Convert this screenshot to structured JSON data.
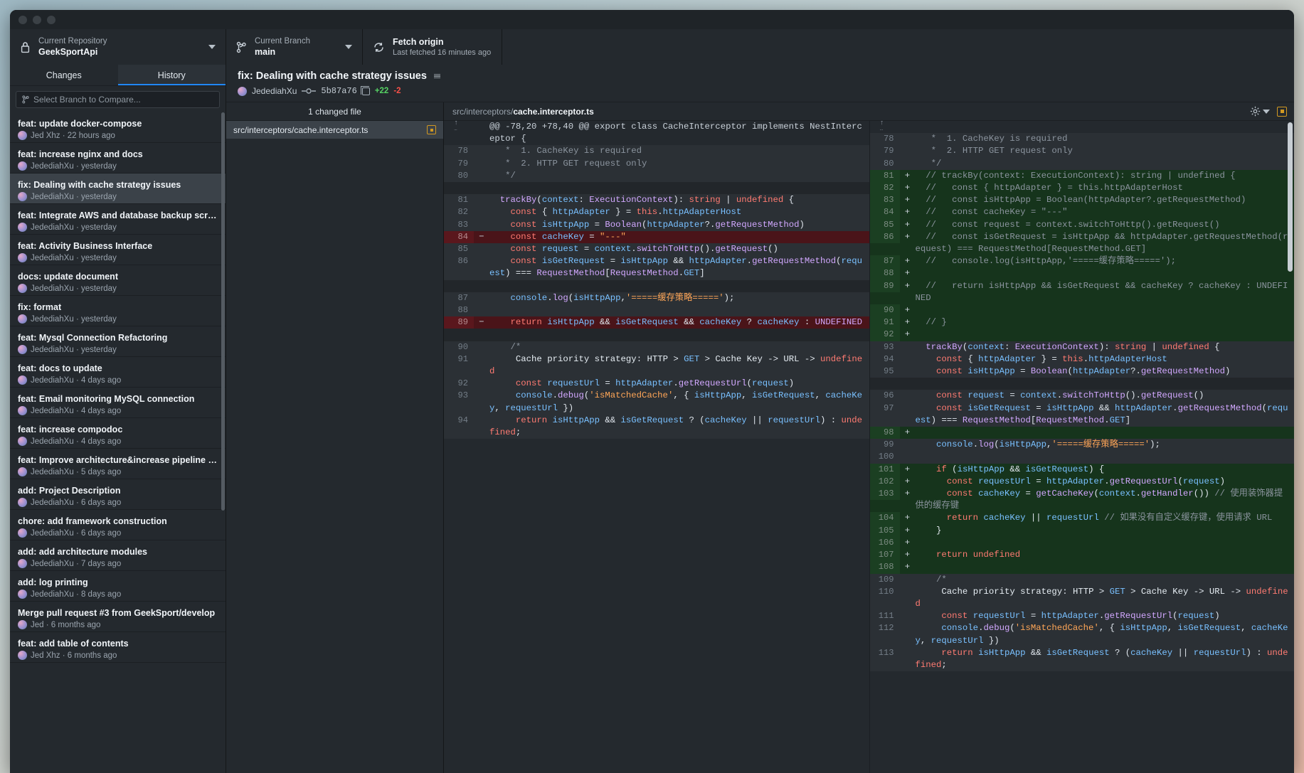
{
  "window": {
    "traffic_lights": 3
  },
  "toolbar": {
    "repo": {
      "label": "Current Repository",
      "value": "GeekSportApi",
      "icon": "lock-icon"
    },
    "branch": {
      "label": "Current Branch",
      "value": "main",
      "icon": "branch-icon"
    },
    "fetch": {
      "title": "Fetch origin",
      "subtitle": "Last fetched 16 minutes ago",
      "icon": "sync-icon"
    }
  },
  "sidebar": {
    "tabs": [
      {
        "label": "Changes",
        "active": false
      },
      {
        "label": "History",
        "active": true
      }
    ],
    "compare": {
      "placeholder": "Select Branch to Compare...",
      "icon": "branch-icon"
    },
    "commits": [
      {
        "title": "feat:  update docker-compose",
        "author": "Jed Xhz",
        "when": "22 hours ago",
        "selected": false
      },
      {
        "title": "feat: increase nginx and docs",
        "author": "JedediahXu",
        "when": "yesterday",
        "selected": false
      },
      {
        "title": "fix: Dealing with cache strategy issues",
        "author": "JedediahXu",
        "when": "yesterday",
        "selected": true
      },
      {
        "title": "feat: Integrate AWS and database backup scripts",
        "author": "JedediahXu",
        "when": "yesterday",
        "selected": false
      },
      {
        "title": "feat: Activity Business Interface",
        "author": "JedediahXu",
        "when": "yesterday",
        "selected": false
      },
      {
        "title": "docs: update document",
        "author": "JedediahXu",
        "when": "yesterday",
        "selected": false
      },
      {
        "title": "fix: format",
        "author": "JedediahXu",
        "when": "yesterday",
        "selected": false
      },
      {
        "title": "feat: Mysql Connection Refactoring",
        "author": "JedediahXu",
        "when": "yesterday",
        "selected": false
      },
      {
        "title": "feat: docs to update",
        "author": "JedediahXu",
        "when": "4 days ago",
        "selected": false
      },
      {
        "title": "feat: Email monitoring MySQL connection",
        "author": "JedediahXu",
        "when": "4 days ago",
        "selected": false
      },
      {
        "title": "feat: increase compodoc",
        "author": "JedediahXu",
        "when": "4 days ago",
        "selected": false
      },
      {
        "title": "feat: Improve architecture&increase pipeline inte...",
        "author": "JedediahXu",
        "when": "5 days ago",
        "selected": false
      },
      {
        "title": "add: Project Description",
        "author": "JedediahXu",
        "when": "6 days ago",
        "selected": false
      },
      {
        "title": "chore: add framework construction",
        "author": "JedediahXu",
        "when": "6 days ago",
        "selected": false
      },
      {
        "title": "add: add architecture modules",
        "author": "JedediahXu",
        "when": "7 days ago",
        "selected": false
      },
      {
        "title": "add: log printing",
        "author": "JedediahXu",
        "when": "8 days ago",
        "selected": false
      },
      {
        "title": "Merge pull request #3 from GeekSport/develop",
        "author": "Jed",
        "when": "6 months ago",
        "selected": false
      },
      {
        "title": "feat: add table of contents",
        "author": "Jed Xhz",
        "when": "6 months ago",
        "selected": false
      }
    ]
  },
  "commit_detail": {
    "title": "fix: Dealing with cache strategy issues",
    "author": "JedediahXu",
    "sha": "5b87a76",
    "additions": "+22",
    "deletions": "-2",
    "changed_files_label": "1 changed file",
    "file": {
      "dir": "src/interceptors/",
      "name": "cache.interceptor.ts",
      "status": "modified"
    },
    "diff_path_dir": "src/interceptors/",
    "diff_path_name": "cache.interceptor.ts"
  },
  "diff": {
    "hunk_header": "@@ -78,20 +78,40 @@ export class CacheInterceptor implements NestInterceptor {",
    "left": [
      {
        "n": "78",
        "type": "ctx",
        "text": "   *  1. CacheKey is required"
      },
      {
        "n": "79",
        "type": "ctx",
        "text": "   *  2. HTTP GET request only"
      },
      {
        "n": "80",
        "type": "ctx",
        "text": "   */"
      },
      {
        "n": "",
        "type": "blank",
        "text": ""
      },
      {
        "n": "81",
        "type": "ctx",
        "text": "  trackBy(context: ExecutionContext): string | undefined {"
      },
      {
        "n": "82",
        "type": "ctx",
        "text": "    const { httpAdapter } = this.httpAdapterHost"
      },
      {
        "n": "83",
        "type": "ctx",
        "text": "    const isHttpApp = Boolean(httpAdapter?.getRequestMethod)"
      },
      {
        "n": "84",
        "type": "del",
        "text": "    const cacheKey = \"---\""
      },
      {
        "n": "85",
        "type": "ctx",
        "text": "    const request = context.switchToHttp().getRequest()"
      },
      {
        "n": "86",
        "type": "ctx",
        "text": "    const isGetRequest = isHttpApp && httpAdapter.getRequestMethod(request) === RequestMethod[RequestMethod.GET]"
      },
      {
        "n": "",
        "type": "blank",
        "text": ""
      },
      {
        "n": "87",
        "type": "ctx",
        "text": "    console.log(isHttpApp,'=====缓存策略=====');"
      },
      {
        "n": "88",
        "type": "ctx",
        "text": ""
      },
      {
        "n": "89",
        "type": "del",
        "text": "    return isHttpApp && isGetRequest && cacheKey ? cacheKey : UNDEFINED"
      },
      {
        "n": "",
        "type": "blank",
        "text": ""
      },
      {
        "n": "90",
        "type": "ctx",
        "text": "    /*"
      },
      {
        "n": "91",
        "type": "ctx",
        "text": "     Cache priority strategy: HTTP > GET > Cache Key -> URL -> undefined"
      },
      {
        "n": "92",
        "type": "ctx",
        "text": "     const requestUrl = httpAdapter.getRequestUrl(request)"
      },
      {
        "n": "93",
        "type": "ctx",
        "text": "     console.debug('isMatchedCache', { isHttpApp, isGetRequest, cacheKey, requestUrl })"
      },
      {
        "n": "94",
        "type": "ctx",
        "text": "     return isHttpApp && isGetRequest ? (cacheKey || requestUrl) : undefined;"
      }
    ],
    "right": [
      {
        "n": "78",
        "type": "ctx",
        "text": "   *  1. CacheKey is required"
      },
      {
        "n": "79",
        "type": "ctx",
        "text": "   *  2. HTTP GET request only"
      },
      {
        "n": "80",
        "type": "ctx",
        "text": "   */"
      },
      {
        "n": "81",
        "type": "add",
        "text": "  // trackBy(context: ExecutionContext): string | undefined {"
      },
      {
        "n": "82",
        "type": "add",
        "text": "  //   const { httpAdapter } = this.httpAdapterHost"
      },
      {
        "n": "83",
        "type": "add",
        "text": "  //   const isHttpApp = Boolean(httpAdapter?.getRequestMethod)"
      },
      {
        "n": "84",
        "type": "add",
        "text": "  //   const cacheKey = \"---\""
      },
      {
        "n": "85",
        "type": "add",
        "text": "  //   const request = context.switchToHttp().getRequest()"
      },
      {
        "n": "86",
        "type": "add",
        "text": "  //   const isGetRequest = isHttpApp && httpAdapter.getRequestMethod(request) === RequestMethod[RequestMethod.GET]"
      },
      {
        "n": "87",
        "type": "add",
        "text": "  //   console.log(isHttpApp,'=====缓存策略=====');"
      },
      {
        "n": "88",
        "type": "add",
        "text": ""
      },
      {
        "n": "89",
        "type": "add",
        "text": "  //   return isHttpApp && isGetRequest && cacheKey ? cacheKey : UNDEFINED"
      },
      {
        "n": "90",
        "type": "add",
        "text": ""
      },
      {
        "n": "91",
        "type": "add",
        "text": "  // }"
      },
      {
        "n": "92",
        "type": "add",
        "text": ""
      },
      {
        "n": "93",
        "type": "ctx",
        "text": "  trackBy(context: ExecutionContext): string | undefined {"
      },
      {
        "n": "94",
        "type": "ctx",
        "text": "    const { httpAdapter } = this.httpAdapterHost"
      },
      {
        "n": "95",
        "type": "ctx",
        "text": "    const isHttpApp = Boolean(httpAdapter?.getRequestMethod)"
      },
      {
        "n": "",
        "type": "blank",
        "text": ""
      },
      {
        "n": "96",
        "type": "ctx",
        "text": "    const request = context.switchToHttp().getRequest()"
      },
      {
        "n": "97",
        "type": "ctx",
        "text": "    const isGetRequest = isHttpApp && httpAdapter.getRequestMethod(request) === RequestMethod[RequestMethod.GET]"
      },
      {
        "n": "98",
        "type": "add",
        "text": ""
      },
      {
        "n": "99",
        "type": "ctx",
        "text": "    console.log(isHttpApp,'=====缓存策略=====');"
      },
      {
        "n": "100",
        "type": "ctx",
        "text": ""
      },
      {
        "n": "101",
        "type": "add",
        "text": "    if (isHttpApp && isGetRequest) {"
      },
      {
        "n": "102",
        "type": "add",
        "text": "      const requestUrl = httpAdapter.getRequestUrl(request)"
      },
      {
        "n": "103",
        "type": "add",
        "text": "      const cacheKey = getCacheKey(context.getHandler()) // 使用装饰器提供的缓存键"
      },
      {
        "n": "104",
        "type": "add",
        "text": "      return cacheKey || requestUrl // 如果没有自定义缓存键，使用请求 URL"
      },
      {
        "n": "105",
        "type": "add",
        "text": "    }"
      },
      {
        "n": "106",
        "type": "add",
        "text": ""
      },
      {
        "n": "107",
        "type": "add",
        "text": "    return undefined"
      },
      {
        "n": "108",
        "type": "add",
        "text": ""
      },
      {
        "n": "109",
        "type": "ctx",
        "text": "    /*"
      },
      {
        "n": "110",
        "type": "ctx",
        "text": "     Cache priority strategy: HTTP > GET > Cache Key -> URL -> undefined"
      },
      {
        "n": "111",
        "type": "ctx",
        "text": "     const requestUrl = httpAdapter.getRequestUrl(request)"
      },
      {
        "n": "112",
        "type": "ctx",
        "text": "     console.debug('isMatchedCache', { isHttpApp, isGetRequest, cacheKey, requestUrl })"
      },
      {
        "n": "113",
        "type": "ctx",
        "text": "     return isHttpApp && isGetRequest ? (cacheKey || requestUrl) : undefined;"
      }
    ]
  },
  "colors": {
    "accent": "#2188ff",
    "addition": "#56d364",
    "deletion": "#f85149",
    "warning": "#d29922",
    "bg": "#24292e"
  }
}
